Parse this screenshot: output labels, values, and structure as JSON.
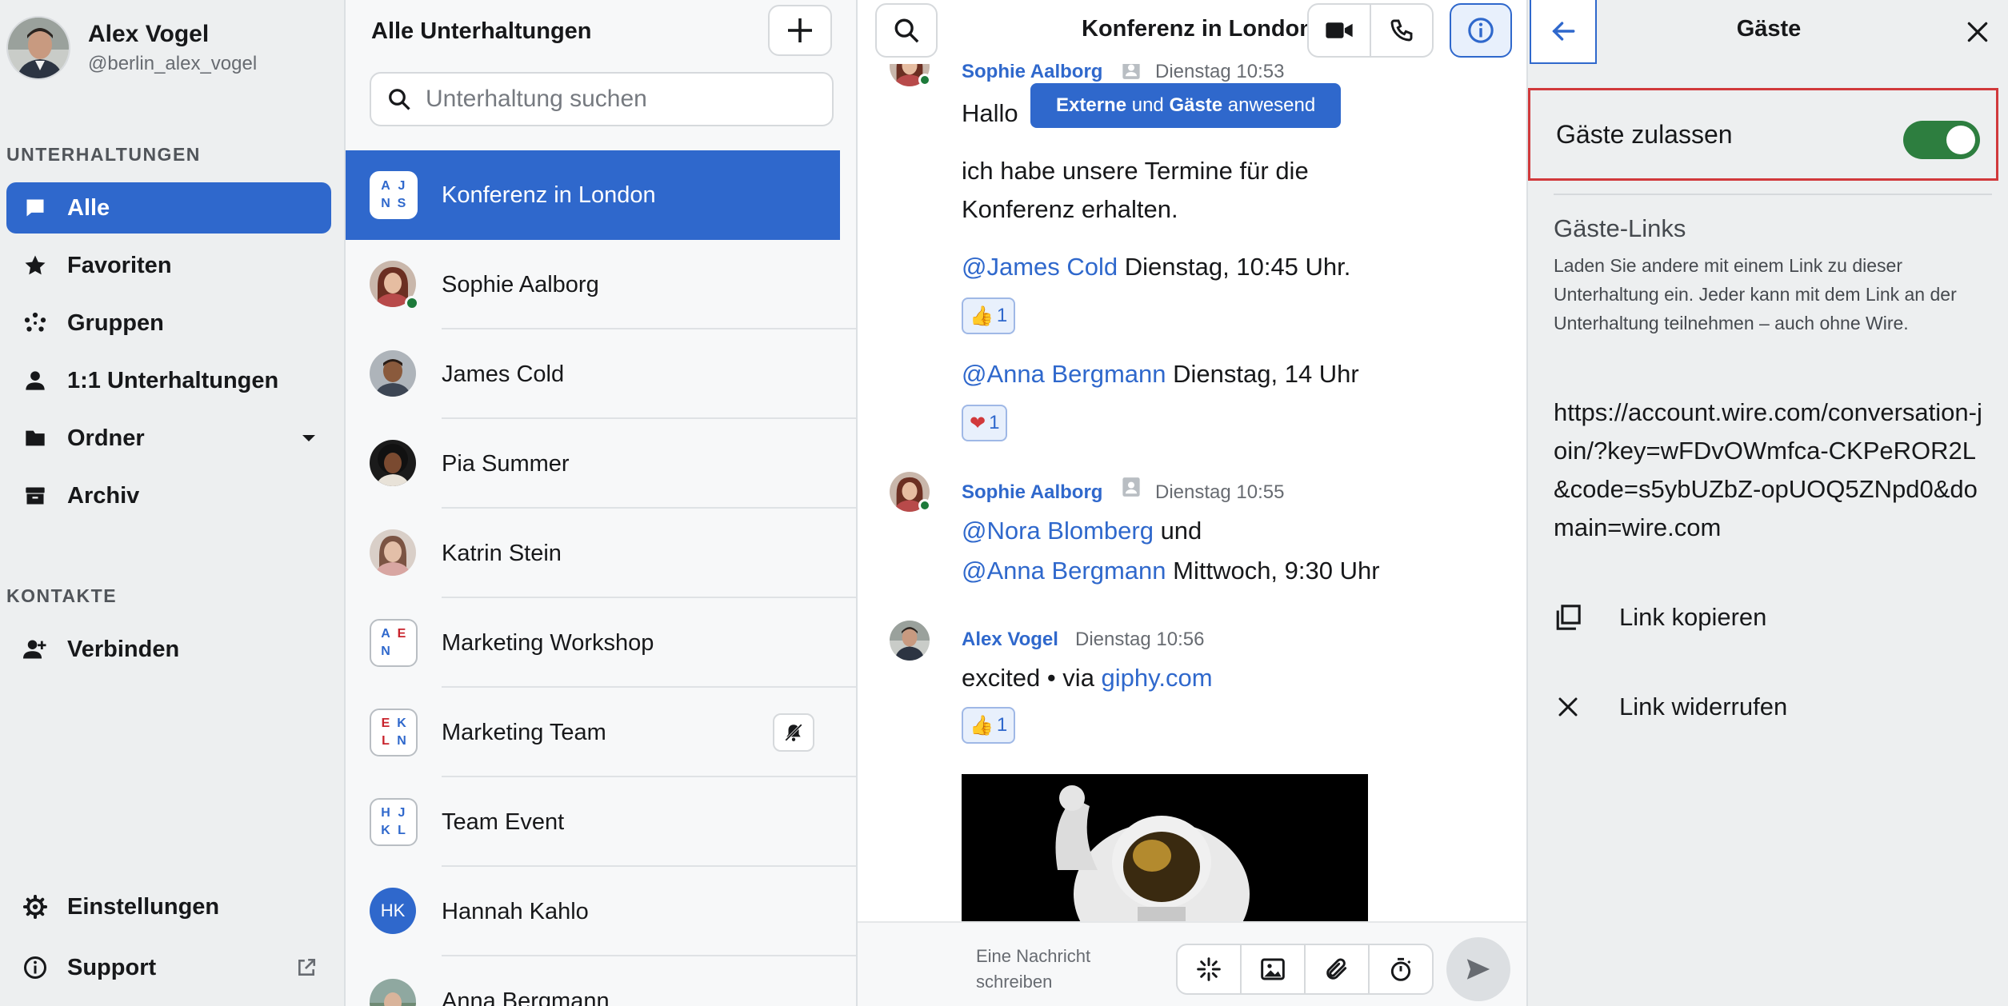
{
  "profile": {
    "name": "Alex Vogel",
    "handle": "@berlin_alex_vogel"
  },
  "sidebar": {
    "conversations_label": "UNTERHALTUNGEN",
    "items": [
      {
        "label": "Alle",
        "icon": "chat-bubble-icon",
        "active": true
      },
      {
        "label": "Favoriten",
        "icon": "star-icon"
      },
      {
        "label": "Gruppen",
        "icon": "groups-icon"
      },
      {
        "label": "1:1 Unterhaltungen",
        "icon": "person-icon"
      },
      {
        "label": "Ordner",
        "icon": "folder-icon"
      },
      {
        "label": "Archiv",
        "icon": "archive-icon"
      }
    ],
    "contacts_label": "KONTAKTE",
    "connect_label": "Verbinden",
    "settings_label": "Einstellungen",
    "support_label": "Support"
  },
  "conversation_list": {
    "title": "Alle Unterhaltungen",
    "search_placeholder": "Unterhaltung suchen",
    "items": [
      {
        "label": "Konferenz in London",
        "type": "group",
        "initials": [
          "A",
          "J",
          "N",
          "S"
        ],
        "active": true
      },
      {
        "label": "Sophie Aalborg",
        "type": "person",
        "online": true
      },
      {
        "label": "James Cold",
        "type": "person"
      },
      {
        "label": "Pia Summer",
        "type": "person"
      },
      {
        "label": "Katrin Stein",
        "type": "person"
      },
      {
        "label": "Marketing Workshop",
        "type": "group",
        "initials": [
          "A",
          "E",
          "N",
          ""
        ]
      },
      {
        "label": "Marketing Team",
        "type": "group",
        "initials": [
          "E",
          "K",
          "L",
          "N"
        ],
        "muted": true
      },
      {
        "label": "Team Event",
        "type": "group",
        "initials": [
          "H",
          "J",
          "K",
          "L"
        ]
      },
      {
        "label": "Hannah Kahlo",
        "type": "initials",
        "initials_text": "HK"
      },
      {
        "label": "Anna Bergmann",
        "type": "person"
      }
    ]
  },
  "chat": {
    "title": "Konferenz in London",
    "banner": {
      "bold": "Externe",
      "mid": " und ",
      "bold2": "Gäste",
      "end": " anwesend"
    },
    "messages": {
      "m1": {
        "sender": "Sophie Aalborg",
        "time": "Dienstag 10:53",
        "greeting": "Hallo",
        "text": "ich habe unsere Termine für die Konferenz erhalten."
      },
      "m2": {
        "mention": "@James Cold",
        "text": " Dienstag, 10:45 Uhr.",
        "reaction_count": "1"
      },
      "m3": {
        "mention": "@Anna Bergmann",
        "text": " Dienstag, 14 Uhr",
        "reaction_count": "1"
      },
      "m4": {
        "sender": "Sophie Aalborg",
        "time": "Dienstag 10:55",
        "mention1": "@Nora Blomberg",
        "and": " und",
        "mention2": "@Anna Bergmann",
        "text": " Mittwoch, 9:30 Uhr"
      },
      "m5": {
        "sender": "Alex Vogel",
        "time": "Dienstag 10:56",
        "text": "excited • via ",
        "link": "giphy.com",
        "reaction_count": "1"
      }
    },
    "composer_placeholder": "Eine Nachricht schreiben"
  },
  "guests_panel": {
    "title": "Gäste",
    "toggle_label": "Gäste zulassen",
    "toggle_on": true,
    "links_title": "Gäste-Links",
    "links_desc": "Laden Sie andere mit einem Link zu dieser Unterhaltung ein. Jeder kann mit dem Link an der Unterhaltung teilnehmen – auch ohne Wire.",
    "link_url": "https://account.wire.com/conversation-join/?key=wFDvOWmfca-CKPeROR2L&code=s5ybUZbZ-opUOQ5ZNpd0&domain=wire.com",
    "copy_label": "Link kopieren",
    "revoke_label": "Link widerrufen"
  },
  "colors": {
    "accent": "#2f68cc",
    "toggle": "#2d7e3f",
    "highlight": "#d1393b"
  }
}
